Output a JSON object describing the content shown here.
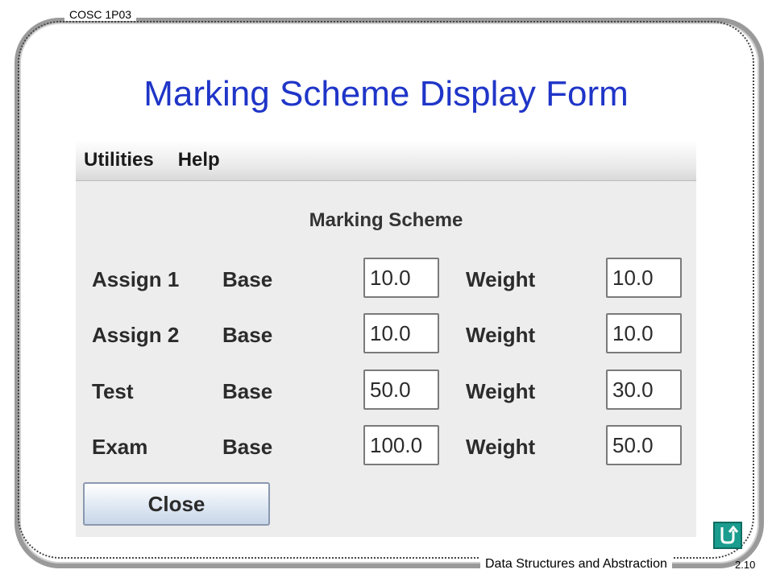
{
  "slide": {
    "header": "COSC 1P03",
    "title": "Marking Scheme Display Form",
    "footer": "Data Structures and Abstraction",
    "page": "2.10"
  },
  "menu": [
    "Utilities",
    "Help"
  ],
  "form": {
    "heading": "Marking Scheme",
    "base_label": "Base",
    "weight_label": "Weight",
    "rows": [
      {
        "name": "Assign 1",
        "base": "10.0",
        "weight": "10.0"
      },
      {
        "name": "Assign 2",
        "base": "10.0",
        "weight": "10.0"
      },
      {
        "name": "Test",
        "base": "50.0",
        "weight": "30.0"
      },
      {
        "name": "Exam",
        "base": "100.0",
        "weight": "50.0"
      }
    ],
    "close_label": "Close"
  },
  "icons": {
    "nav": "return-arrow-icon"
  },
  "colors": {
    "title": "#1f35c8",
    "nav_icon": "#1a9c8e"
  }
}
